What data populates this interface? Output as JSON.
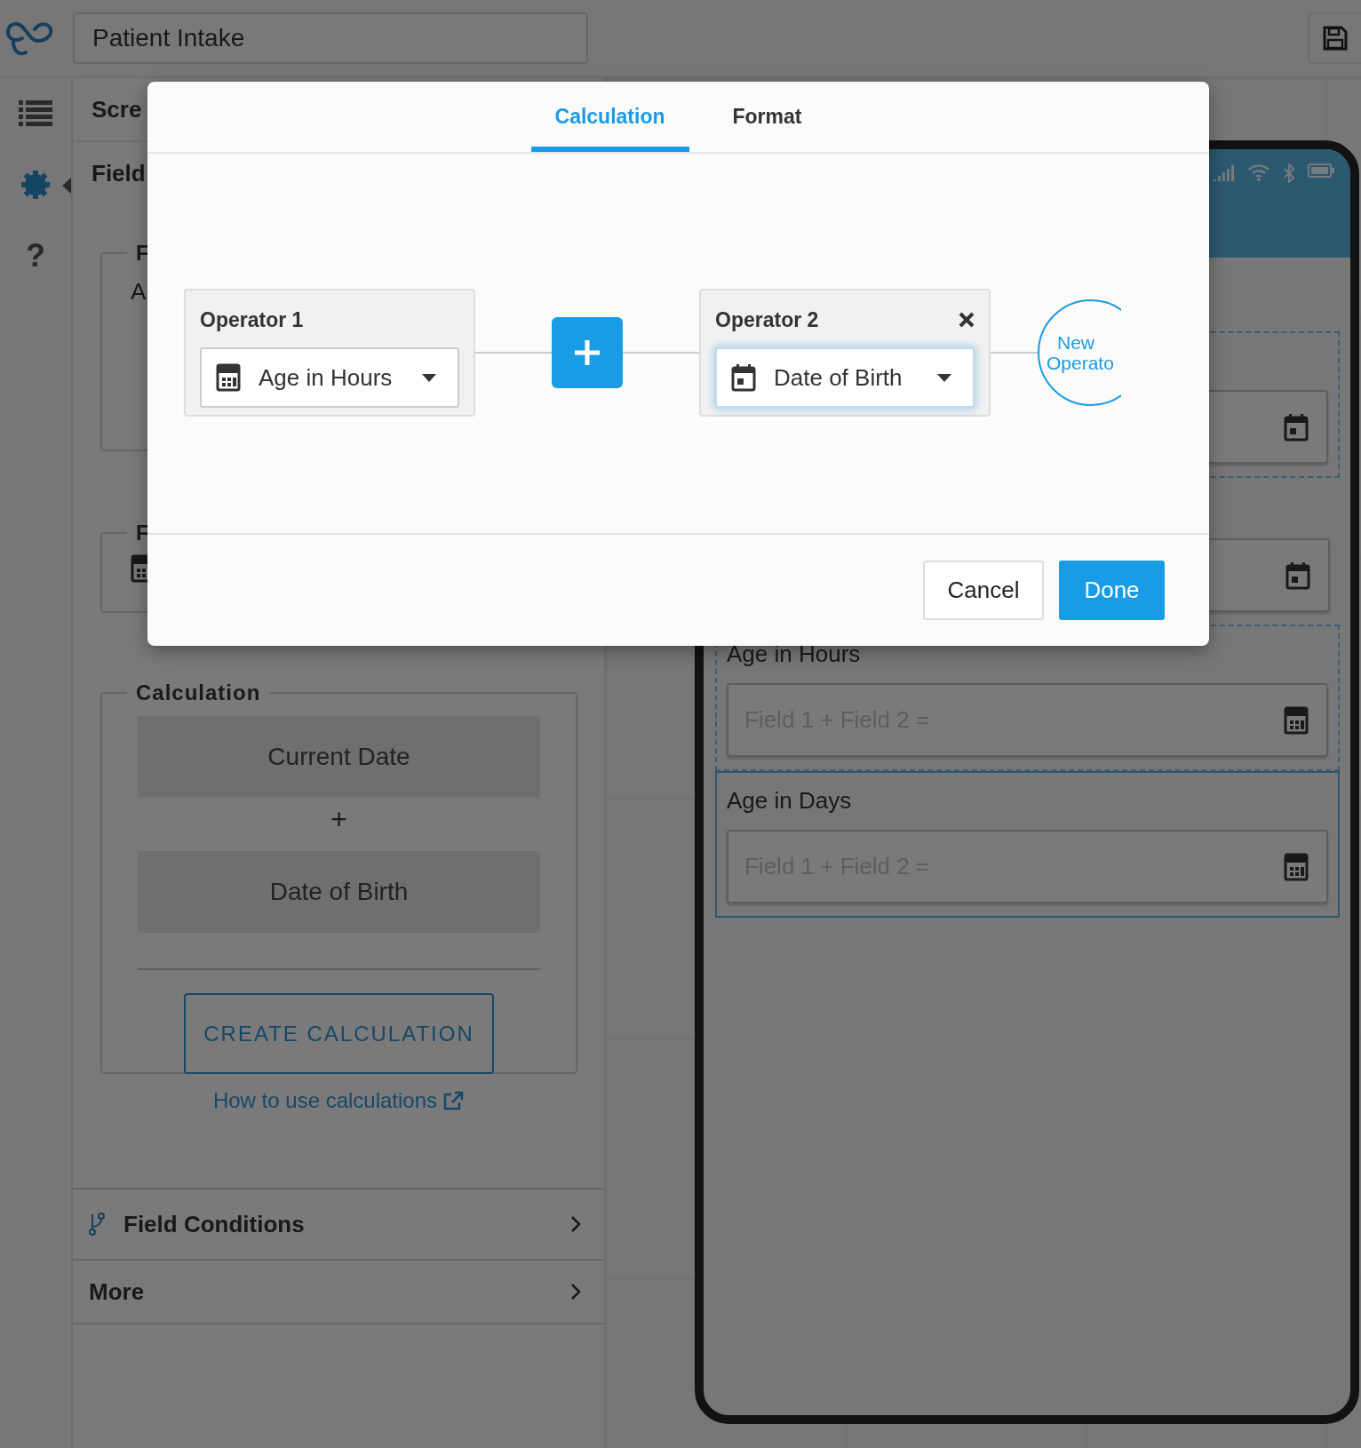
{
  "header": {
    "title": "Patient Intake"
  },
  "rail": {
    "help": "?"
  },
  "panel": {
    "screen_heading": "Scre",
    "field_heading": "Field",
    "groups": [
      {
        "legend": "F",
        "text": "A",
        "kind": "text"
      },
      {
        "legend": "F",
        "kind": "calculator"
      }
    ],
    "calculation": {
      "legend": "Calculation",
      "operands": [
        "Current Date",
        "Date of Birth"
      ],
      "operator": "+",
      "button": "CREATE CALCULATION"
    },
    "help_link": "How to use calculations",
    "sections": [
      {
        "label": "Field Conditions",
        "kind": "conditions"
      },
      {
        "label": "More",
        "kind": "plain"
      }
    ]
  },
  "preview": {
    "fields": [
      {
        "kind": "date",
        "highlighted": true,
        "selected": false
      },
      {
        "kind": "date",
        "highlighted": false,
        "selected": false
      },
      {
        "kind": "calculator",
        "label": "Age in Hours",
        "placeholder": "Field 1 + Field 2 =",
        "highlighted": true,
        "selected": false
      },
      {
        "kind": "calculator",
        "label": "Age in Days",
        "placeholder": "Field 1 + Field 2 =",
        "highlighted": false,
        "selected": true
      }
    ]
  },
  "dialog": {
    "tabs": [
      {
        "label": "Calculation",
        "selected": true
      },
      {
        "label": "Format",
        "selected": false
      }
    ],
    "operators": [
      {
        "title": "Operator 1",
        "value": "Age in Hours",
        "kind": "calculator",
        "removable": false,
        "focused": false
      },
      {
        "title": "Operator 2",
        "value": "Date of Birth",
        "kind": "date",
        "removable": true,
        "focused": true
      }
    ],
    "new_operator": [
      "New",
      "Operato"
    ],
    "buttons": [
      {
        "label": "Cancel",
        "kind": "secondary"
      },
      {
        "label": "Done",
        "kind": "primary"
      }
    ]
  }
}
